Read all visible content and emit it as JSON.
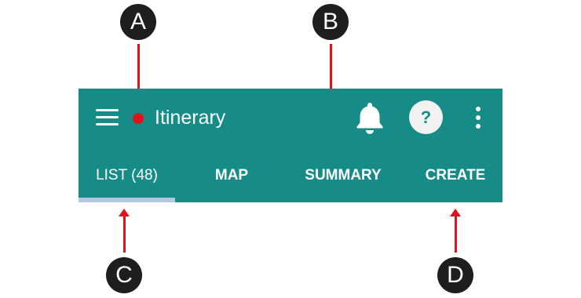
{
  "colors": {
    "brand": "#178b87",
    "tab_indicator": "#b4c8e6",
    "annotation_marker": "#e0131a",
    "callout_badge": "#1e1e1e"
  },
  "appbar": {
    "menu_icon": "hamburger-menu-icon",
    "title": "Itinerary",
    "notification_icon": "bell-icon",
    "help_label": "?",
    "overflow_icon": "vertical-ellipsis-icon"
  },
  "tabs": [
    {
      "label": "LIST (48)",
      "active": true
    },
    {
      "label": "MAP",
      "active": false
    },
    {
      "label": "SUMMARY",
      "active": false
    },
    {
      "label": "CREATE",
      "active": false
    }
  ],
  "callouts": {
    "a": "A",
    "b": "B",
    "c": "C",
    "d": "D"
  }
}
